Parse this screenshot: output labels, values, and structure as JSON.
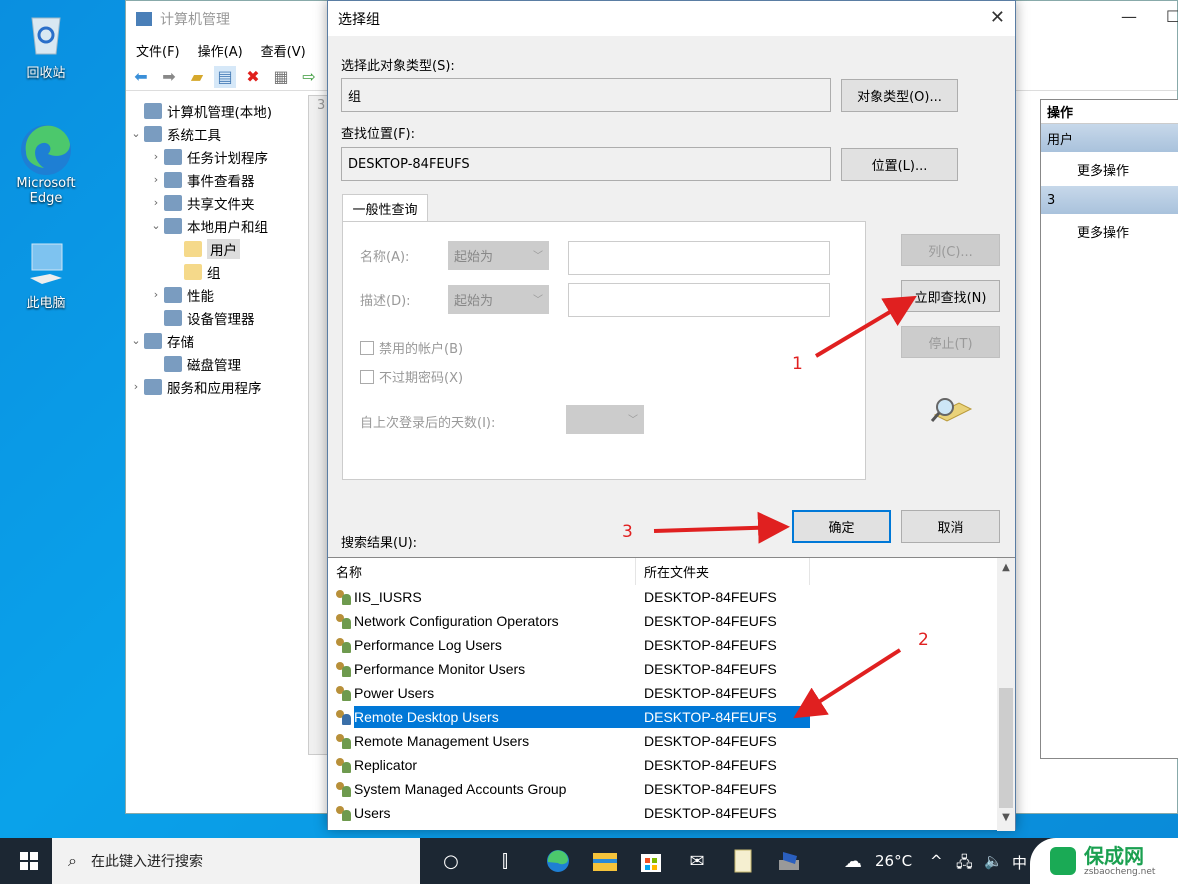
{
  "desktop": {
    "icons": [
      {
        "label": "回收站",
        "icon": "recycle-bin-icon"
      },
      {
        "label": "Microsoft Edge",
        "icon": "edge-icon"
      },
      {
        "label": "此电脑",
        "icon": "computer-icon"
      }
    ]
  },
  "mmc": {
    "title": "计算机管理",
    "menu": [
      "文件(F)",
      "操作(A)",
      "查看(V)"
    ],
    "tree": [
      {
        "label": "计算机管理(本地)",
        "level": 0,
        "expander": "",
        "icon": "computer-management-icon"
      },
      {
        "label": "系统工具",
        "level": 0,
        "expander": "expanded",
        "icon": "tools-icon"
      },
      {
        "label": "任务计划程序",
        "level": 1,
        "expander": "collapsed",
        "icon": "clock-icon"
      },
      {
        "label": "事件查看器",
        "level": 1,
        "expander": "collapsed",
        "icon": "event-viewer-icon"
      },
      {
        "label": "共享文件夹",
        "level": 1,
        "expander": "collapsed",
        "icon": "shared-folder-icon"
      },
      {
        "label": "本地用户和组",
        "level": 1,
        "expander": "expanded",
        "icon": "users-groups-icon"
      },
      {
        "label": "用户",
        "level": 2,
        "expander": "",
        "icon": "folder-icon",
        "selected": true
      },
      {
        "label": "组",
        "level": 2,
        "expander": "",
        "icon": "folder-icon"
      },
      {
        "label": "性能",
        "level": 1,
        "expander": "collapsed",
        "icon": "performance-icon"
      },
      {
        "label": "设备管理器",
        "level": 1,
        "expander": "",
        "icon": "device-manager-icon"
      },
      {
        "label": "存储",
        "level": 0,
        "expander": "expanded",
        "icon": "storage-icon"
      },
      {
        "label": "磁盘管理",
        "level": 1,
        "expander": "",
        "icon": "disk-icon"
      },
      {
        "label": "服务和应用程序",
        "level": 0,
        "expander": "collapsed",
        "icon": "services-icon"
      }
    ],
    "middle_partial_text": "3",
    "actions": {
      "header": "操作",
      "groups": [
        {
          "title": "用户",
          "item": "更多操作"
        },
        {
          "title": "3",
          "item": "更多操作"
        }
      ]
    }
  },
  "dialog": {
    "title": "选择组",
    "object_type_label": "选择此对象类型(S):",
    "object_type_value": "组",
    "object_type_button": "对象类型(O)...",
    "location_label": "查找位置(F):",
    "location_value": "DESKTOP-84FEUFS",
    "location_button": "位置(L)...",
    "tab": "一般性查询",
    "name_label": "名称(A):",
    "name_mode": "起始为",
    "name_value": "",
    "desc_label": "描述(D):",
    "desc_mode": "起始为",
    "desc_value": "",
    "disabled_accounts": "禁用的帐户(B)",
    "non_expiring": "不过期密码(X)",
    "days_label": "自上次登录后的天数(I):",
    "days_value": "",
    "columns_button": "列(C)...",
    "find_now_button": "立即查找(N)",
    "stop_button": "停止(T)",
    "ok_button": "确定",
    "cancel_button": "取消",
    "results_label": "搜索结果(U):",
    "results": {
      "columns": [
        "名称",
        "所在文件夹"
      ],
      "rows": [
        {
          "name": "IIS_IUSRS",
          "folder": "DESKTOP-84FEUFS"
        },
        {
          "name": "Network Configuration Operators",
          "folder": "DESKTOP-84FEUFS"
        },
        {
          "name": "Performance Log Users",
          "folder": "DESKTOP-84FEUFS"
        },
        {
          "name": "Performance Monitor Users",
          "folder": "DESKTOP-84FEUFS"
        },
        {
          "name": "Power Users",
          "folder": "DESKTOP-84FEUFS"
        },
        {
          "name": "Remote Desktop Users",
          "folder": "DESKTOP-84FEUFS",
          "selected": true
        },
        {
          "name": "Remote Management Users",
          "folder": "DESKTOP-84FEUFS"
        },
        {
          "name": "Replicator",
          "folder": "DESKTOP-84FEUFS"
        },
        {
          "name": "System Managed Accounts Group",
          "folder": "DESKTOP-84FEUFS"
        },
        {
          "name": "Users",
          "folder": "DESKTOP-84FEUFS"
        }
      ]
    }
  },
  "annotations": [
    "1",
    "2",
    "3"
  ],
  "taskbar": {
    "search_placeholder": "在此键入进行搜索",
    "weather": "26°C",
    "ime": "中"
  },
  "watermark": {
    "title": "保成网",
    "url": "zsbaocheng.net"
  },
  "colors": {
    "selection": "#0078d7",
    "annotation": "#e02020",
    "taskbar": "#1c2733"
  }
}
